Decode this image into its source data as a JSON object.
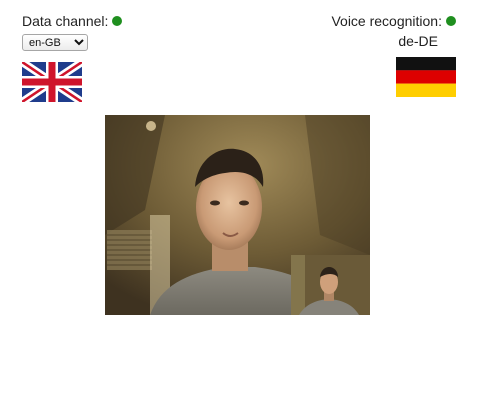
{
  "data_channel": {
    "label": "Data channel:",
    "status_color": "#1f8f1f",
    "language_select": {
      "selected": "en-GB"
    },
    "flag_icon": "uk-flag-icon"
  },
  "voice_recognition": {
    "label": "Voice recognition:",
    "status_color": "#1f8f1f",
    "language": "de-DE",
    "flag_icon": "germany-flag-icon"
  },
  "video": {
    "remote_icon": "remote-video-feed",
    "local_icon": "local-video-preview"
  }
}
